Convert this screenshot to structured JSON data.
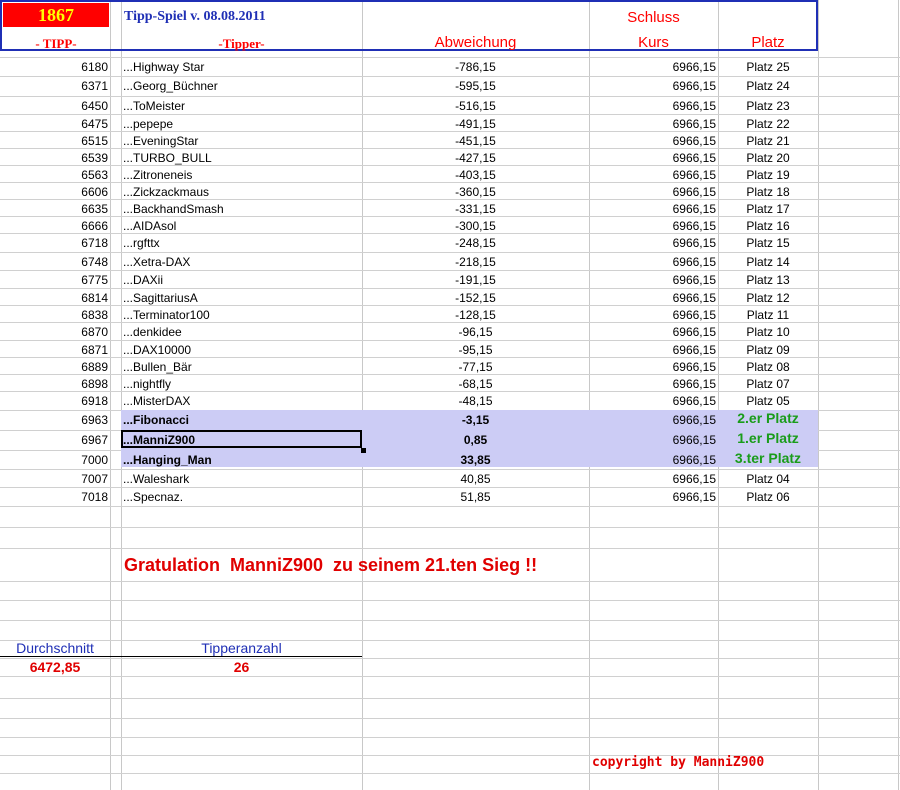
{
  "header": {
    "badge": "1867",
    "title": "Tipp-Spiel v. 08.08.2011",
    "schluss": "Schluss",
    "col_tipp": "- TIPP-",
    "col_tipper": "-Tipper-",
    "col_abweichung": "Abweichung",
    "col_kurs": "Kurs",
    "col_platz": "Platz"
  },
  "rows": [
    {
      "tipp": "6180",
      "tipper": "...Highway Star",
      "abw": "-786,15",
      "kurs": "6966,15",
      "platz": "Platz 25"
    },
    {
      "tipp": "6371",
      "tipper": "...Georg_Büchner",
      "abw": "-595,15",
      "kurs": "6966,15",
      "platz": "Platz 24"
    },
    {
      "tipp": "6450",
      "tipper": "...ToMeister",
      "abw": "-516,15",
      "kurs": "6966,15",
      "platz": "Platz 23"
    },
    {
      "tipp": "6475",
      "tipper": "...pepepe",
      "abw": "-491,15",
      "kurs": "6966,15",
      "platz": "Platz 22"
    },
    {
      "tipp": "6515",
      "tipper": "...EveningStar",
      "abw": "-451,15",
      "kurs": "6966,15",
      "platz": "Platz 21"
    },
    {
      "tipp": "6539",
      "tipper": "...TURBO_BULL",
      "abw": "-427,15",
      "kurs": "6966,15",
      "platz": "Platz 20"
    },
    {
      "tipp": "6563",
      "tipper": "...Zitroneneis",
      "abw": "-403,15",
      "kurs": "6966,15",
      "platz": "Platz 19"
    },
    {
      "tipp": "6606",
      "tipper": "...Zickzackmaus",
      "abw": "-360,15",
      "kurs": "6966,15",
      "platz": "Platz 18"
    },
    {
      "tipp": "6635",
      "tipper": "...BackhandSmash",
      "abw": "-331,15",
      "kurs": "6966,15",
      "platz": "Platz 17"
    },
    {
      "tipp": "6666",
      "tipper": "...AIDAsol",
      "abw": "-300,15",
      "kurs": "6966,15",
      "platz": "Platz 16"
    },
    {
      "tipp": "6718",
      "tipper": "...rgfttx",
      "abw": "-248,15",
      "kurs": "6966,15",
      "platz": "Platz 15"
    },
    {
      "tipp": "6748",
      "tipper": "...Xetra-DAX",
      "abw": "-218,15",
      "kurs": "6966,15",
      "platz": "Platz 14"
    },
    {
      "tipp": "6775",
      "tipper": "...DAXii",
      "abw": "-191,15",
      "kurs": "6966,15",
      "platz": "Platz 13"
    },
    {
      "tipp": "6814",
      "tipper": "...SagittariusA",
      "abw": "-152,15",
      "kurs": "6966,15",
      "platz": "Platz 12"
    },
    {
      "tipp": "6838",
      "tipper": "...Terminator100",
      "abw": "-128,15",
      "kurs": "6966,15",
      "platz": "Platz 11"
    },
    {
      "tipp": "6870",
      "tipper": "...denkidee",
      "abw": "-96,15",
      "kurs": "6966,15",
      "platz": "Platz 10"
    },
    {
      "tipp": "6871",
      "tipper": "...DAX10000",
      "abw": "-95,15",
      "kurs": "6966,15",
      "platz": "Platz 09"
    },
    {
      "tipp": "6889",
      "tipper": "...Bullen_Bär",
      "abw": "-77,15",
      "kurs": "6966,15",
      "platz": "Platz 08"
    },
    {
      "tipp": "6898",
      "tipper": "...nightfly",
      "abw": "-68,15",
      "kurs": "6966,15",
      "platz": "Platz 07"
    },
    {
      "tipp": "6918",
      "tipper": "...MisterDAX",
      "abw": "-48,15",
      "kurs": "6966,15",
      "platz": "Platz 05"
    },
    {
      "tipp": "6963",
      "tipper": "...Fibonacci",
      "abw": "-3,15",
      "kurs": "6966,15",
      "platz": "2.er Platz"
    },
    {
      "tipp": "6967",
      "tipper": "...ManniZ900",
      "abw": "0,85",
      "kurs": "6966,15",
      "platz": "1.er Platz"
    },
    {
      "tipp": "7000",
      "tipper": "...Hanging_Man",
      "abw": "33,85",
      "kurs": "6966,15",
      "platz": "3.ter Platz"
    },
    {
      "tipp": "7007",
      "tipper": "...Waleshark",
      "abw": "40,85",
      "kurs": "6966,15",
      "platz": "Platz 04"
    },
    {
      "tipp": "7018",
      "tipper": "...Specnaz.",
      "abw": "51,85",
      "kurs": "6966,15",
      "platz": "Platz 06"
    }
  ],
  "gratulation": "Gratulation  ManniZ900  zu seinem 21.ten Sieg !!",
  "stats": {
    "avg_label": "Durchschnitt",
    "avg_value": "6472,85",
    "count_label": "Tipperanzahl",
    "count_value": "26"
  },
  "copyright": "copyright by ManniZ900",
  "colors": {
    "accent_red": "#ff0000",
    "frame_blue": "#1f2fb5",
    "highlight": "#ccccf5",
    "winner_green": "#1a9c1a"
  }
}
